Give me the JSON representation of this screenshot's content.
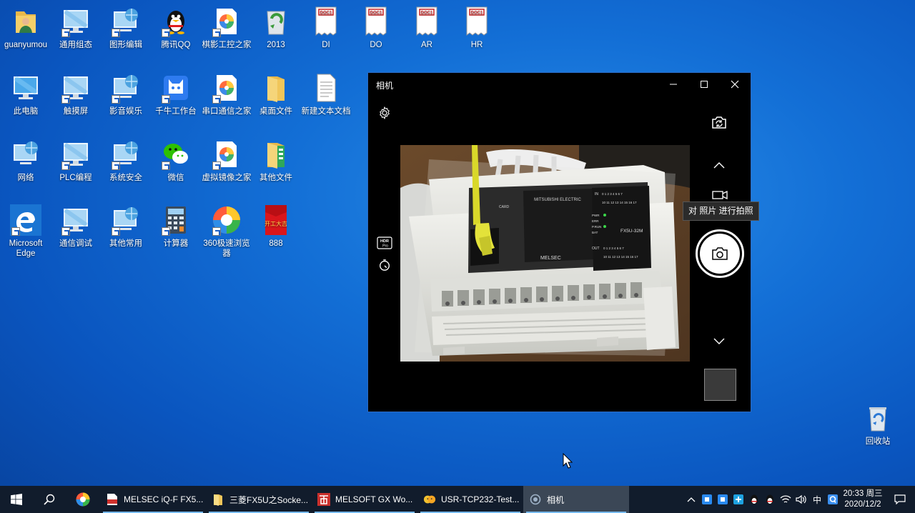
{
  "desktop_icons": {
    "guanyumou": "guanyumou",
    "tongyong_zutai": "通用组态",
    "tuxing_bianji": "图形编辑",
    "tengxun_qq": "腾讯QQ",
    "qiying_gongkong": "棋影工控之家",
    "folder_2013": "2013",
    "doc_di": "DI",
    "doc_do": "DO",
    "doc_ar": "AR",
    "doc_hr": "HR",
    "ci_diannao": "此电脑",
    "chumoping": "触摸屏",
    "yingyin_yule": "影音娱乐",
    "qianniu": "千牛工作台",
    "chuankou_tongxin": "串口通信之家",
    "zhuomian_wenjian": "桌面文件",
    "xinjian_wenben": "新建文本文档",
    "wangluo": "网络",
    "plc_biancheng": "PLC编程",
    "xitong_anquan": "系统安全",
    "weixin": "微信",
    "xuni_jingxiang": "虚拟镜像之家",
    "qita_wenjian": "其他文件",
    "edge": "Microsoft Edge",
    "tongxin_tiaoshi": "通信调试",
    "qita_changyong": "其他常用",
    "jisuanqi": "计算器",
    "browser_360": "360极速浏览器",
    "app_888": "888",
    "huishouzhan": "回收站",
    "doc_badge": "DOC1",
    "red_badge_text": "开工大吉"
  },
  "camera_window": {
    "title": "相机",
    "tooltip": "对 照片 进行拍照",
    "hdr_label": "HDR Pro",
    "preview": {
      "brand": "MITSUBISHI ELECTRIC",
      "model": "FX5U-32M",
      "panel_brand": "MELSEC",
      "card_label": "CARD",
      "in_label": "IN",
      "out_label": "OUT",
      "in_nums": "0 1 2 3 4 5 6 7",
      "in_nums2": "10 11 12 13 14 15 16 17",
      "led_labels": [
        "PWR",
        "ERR",
        "P.RUN",
        "BAT"
      ]
    }
  },
  "taskbar": {
    "apps": [
      {
        "label": "MELSEC iQ-F FX5...",
        "active": false
      },
      {
        "label": "三菱FX5U之Socke...",
        "active": false
      },
      {
        "label": "MELSOFT GX Wo...",
        "active": false
      },
      {
        "label": "USR-TCP232-Test...",
        "active": false
      },
      {
        "label": "相机",
        "active": true
      }
    ],
    "ime": "中",
    "time": "20:33 周三",
    "date": "2020/12/2"
  },
  "colors": {
    "accent": "#76b9ed",
    "taskbar_bg": "#111c2c",
    "desktop_blue": "#136fd6"
  }
}
